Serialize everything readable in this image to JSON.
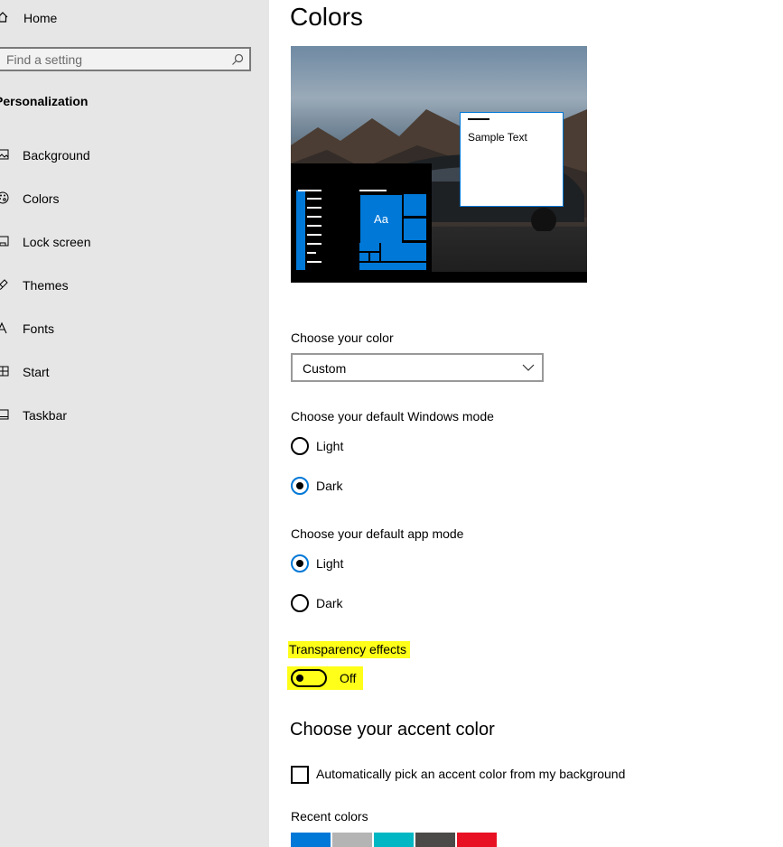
{
  "sidebar": {
    "home_label": "Home",
    "search_placeholder": "Find a setting",
    "section_title": "Personalization",
    "items": [
      {
        "label": "Background",
        "icon": "picture-icon"
      },
      {
        "label": "Colors",
        "icon": "palette-icon"
      },
      {
        "label": "Lock screen",
        "icon": "lock-screen-icon"
      },
      {
        "label": "Themes",
        "icon": "brush-icon"
      },
      {
        "label": "Fonts",
        "icon": "font-icon"
      },
      {
        "label": "Start",
        "icon": "start-icon"
      },
      {
        "label": "Taskbar",
        "icon": "taskbar-icon"
      }
    ]
  },
  "main": {
    "title": "Colors",
    "preview": {
      "sample_text": "Sample Text",
      "tile_text": "Aa"
    },
    "choose_color": {
      "label": "Choose your color",
      "value": "Custom"
    },
    "windows_mode": {
      "label": "Choose your default Windows mode",
      "options": [
        "Light",
        "Dark"
      ],
      "selected": "Dark"
    },
    "app_mode": {
      "label": "Choose your default app mode",
      "options": [
        "Light",
        "Dark"
      ],
      "selected": "Light"
    },
    "transparency": {
      "label": "Transparency effects",
      "state": "Off"
    },
    "accent": {
      "heading": "Choose your accent color",
      "auto_pick_label": "Automatically pick an accent color from my background",
      "recent_label": "Recent colors",
      "recent_colors": [
        "#0078d7",
        "#b4b4b4",
        "#00b7c3",
        "#4c4a48",
        "#e81123"
      ]
    }
  },
  "colors": {
    "accent": "#0078d7",
    "highlight": "#ffff1a",
    "sidebar_bg": "#e6e6e6"
  }
}
